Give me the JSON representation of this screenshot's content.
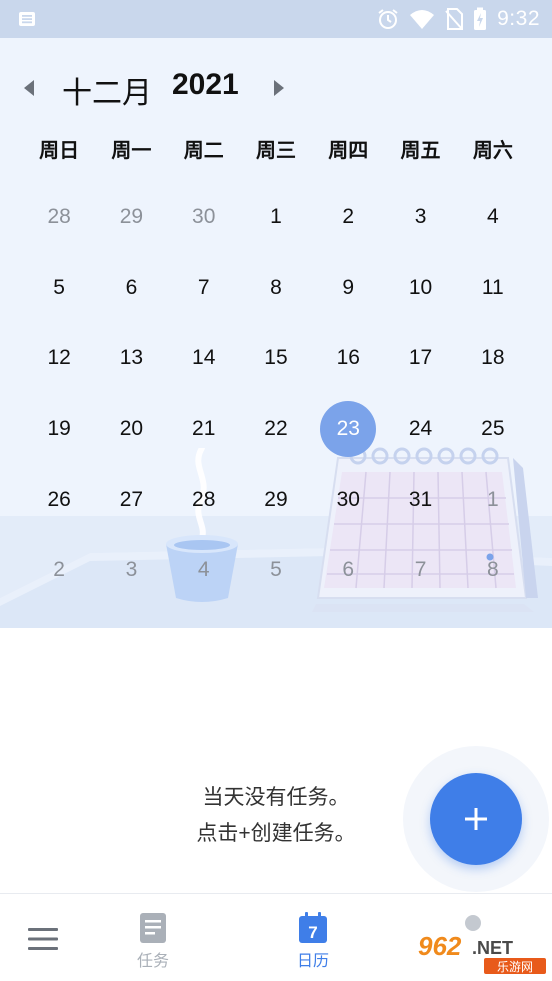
{
  "status_bar": {
    "time": "9:32",
    "icons": [
      "notification-icon",
      "alarm-icon",
      "wifi-icon",
      "no-sim-icon",
      "battery-charging-icon"
    ]
  },
  "calendar": {
    "month": "十二月",
    "year": "2021",
    "weekdays": [
      "周日",
      "周一",
      "周二",
      "周三",
      "周四",
      "周五",
      "周六"
    ],
    "weeks": [
      [
        {
          "d": "28",
          "cur": false
        },
        {
          "d": "29",
          "cur": false
        },
        {
          "d": "30",
          "cur": false
        },
        {
          "d": "1",
          "cur": true
        },
        {
          "d": "2",
          "cur": true
        },
        {
          "d": "3",
          "cur": true
        },
        {
          "d": "4",
          "cur": true
        }
      ],
      [
        {
          "d": "5",
          "cur": true
        },
        {
          "d": "6",
          "cur": true
        },
        {
          "d": "7",
          "cur": true
        },
        {
          "d": "8",
          "cur": true
        },
        {
          "d": "9",
          "cur": true
        },
        {
          "d": "10",
          "cur": true
        },
        {
          "d": "11",
          "cur": true
        }
      ],
      [
        {
          "d": "12",
          "cur": true
        },
        {
          "d": "13",
          "cur": true
        },
        {
          "d": "14",
          "cur": true
        },
        {
          "d": "15",
          "cur": true
        },
        {
          "d": "16",
          "cur": true
        },
        {
          "d": "17",
          "cur": true
        },
        {
          "d": "18",
          "cur": true
        }
      ],
      [
        {
          "d": "19",
          "cur": true
        },
        {
          "d": "20",
          "cur": true
        },
        {
          "d": "21",
          "cur": true
        },
        {
          "d": "22",
          "cur": true
        },
        {
          "d": "23",
          "cur": true,
          "today": true
        },
        {
          "d": "24",
          "cur": true
        },
        {
          "d": "25",
          "cur": true
        }
      ],
      [
        {
          "d": "26",
          "cur": true
        },
        {
          "d": "27",
          "cur": true
        },
        {
          "d": "28",
          "cur": true
        },
        {
          "d": "29",
          "cur": true
        },
        {
          "d": "30",
          "cur": true
        },
        {
          "d": "31",
          "cur": true
        },
        {
          "d": "1",
          "cur": false
        }
      ],
      [
        {
          "d": "2",
          "cur": false
        },
        {
          "d": "3",
          "cur": false
        },
        {
          "d": "4",
          "cur": false
        },
        {
          "d": "5",
          "cur": false
        },
        {
          "d": "6",
          "cur": false
        },
        {
          "d": "7",
          "cur": false
        },
        {
          "d": "8",
          "cur": false
        }
      ]
    ]
  },
  "empty_state": {
    "line1": "当天没有任务。",
    "line2": "点击+创建任务。"
  },
  "bottom_nav": {
    "tasks_label": "任务",
    "calendar_label": "日历",
    "calendar_icon_number": "7"
  },
  "watermark": {
    "brand": "962",
    "suffix": ".NET",
    "caption": "乐游网"
  },
  "colors": {
    "accent": "#3f7ee8",
    "today_circle": "#7ba3ea",
    "status_bar": "#c9d7ec",
    "calendar_bg": "#eef4fd"
  }
}
